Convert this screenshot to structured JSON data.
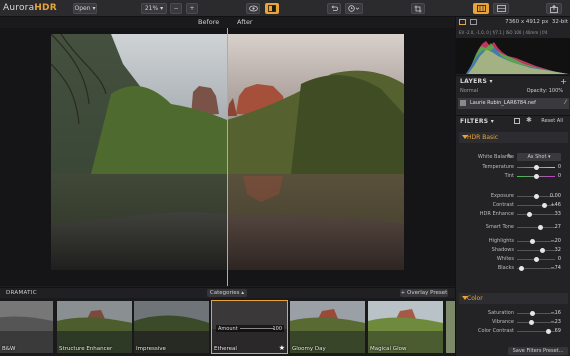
{
  "app": {
    "logo_prefix": "Aurora",
    "logo_suffix": "HDR"
  },
  "toolbar": {
    "open_label": "Open",
    "zoom_label": "21%",
    "zoom_minus": "−",
    "zoom_plus": "+"
  },
  "compare": {
    "before_label": "Before",
    "after_label": "After"
  },
  "filmstrip": {
    "section_label": "DRAMATIC",
    "categories_label": "Categories",
    "overlay_label": "+ Overlay Preset",
    "amount_label": "Amount",
    "amount_value": "100",
    "items": [
      {
        "label": "B&W"
      },
      {
        "label": "Structure Enhancer"
      },
      {
        "label": "Impressive"
      },
      {
        "label": "Ethereal"
      },
      {
        "label": "Gloomy Day"
      },
      {
        "label": "Magical Glow"
      }
    ]
  },
  "panel": {
    "dims": "7360 x 4912 px",
    "bitdepth": "32-bit",
    "exif": "EV -2.0, -1.0, 0 | f/7.1 | ISO 100 | 40mm | f/4",
    "layers_label": "LAYERS",
    "blend_mode": "Normal",
    "opacity_label": "Opacity: 100%",
    "layer_name": "Laurie Rubin_LAR6784.nef",
    "filters_label": "FILTERS",
    "reset_label": "Reset All",
    "hdr_basic_label": "HDR Basic",
    "white_balance_label": "White Balance",
    "white_balance_value": "As Shot",
    "color_label": "Color",
    "save_filters_label": "Save Filters Preset..."
  },
  "sliders": [
    {
      "label": "Temperature",
      "value": "0",
      "frac": 0.5
    },
    {
      "label": "Tint",
      "value": "0",
      "frac": 0.5
    },
    {
      "label": "Exposure",
      "value": "0.00",
      "frac": 0.5
    },
    {
      "label": "Contrast",
      "value": "+46",
      "frac": 0.73
    },
    {
      "label": "HDR Enhance",
      "value": "33",
      "frac": 0.33
    },
    {
      "label": "Smart Tone",
      "value": "27",
      "frac": 0.63
    },
    {
      "label": "Highlights",
      "value": "−20",
      "frac": 0.4
    },
    {
      "label": "Shadows",
      "value": "32",
      "frac": 0.66
    },
    {
      "label": "Whites",
      "value": "0",
      "frac": 0.5
    },
    {
      "label": "Blacks",
      "value": "−74",
      "frac": 0.13
    },
    {
      "label": "Saturation",
      "value": "−16",
      "frac": 0.42
    },
    {
      "label": "Vibrance",
      "value": "−23",
      "frac": 0.38
    },
    {
      "label": "Color Contrast",
      "value": "69",
      "frac": 0.84
    }
  ],
  "colors": {
    "accent": "#e8a33a",
    "panel_bg": "#232326"
  }
}
